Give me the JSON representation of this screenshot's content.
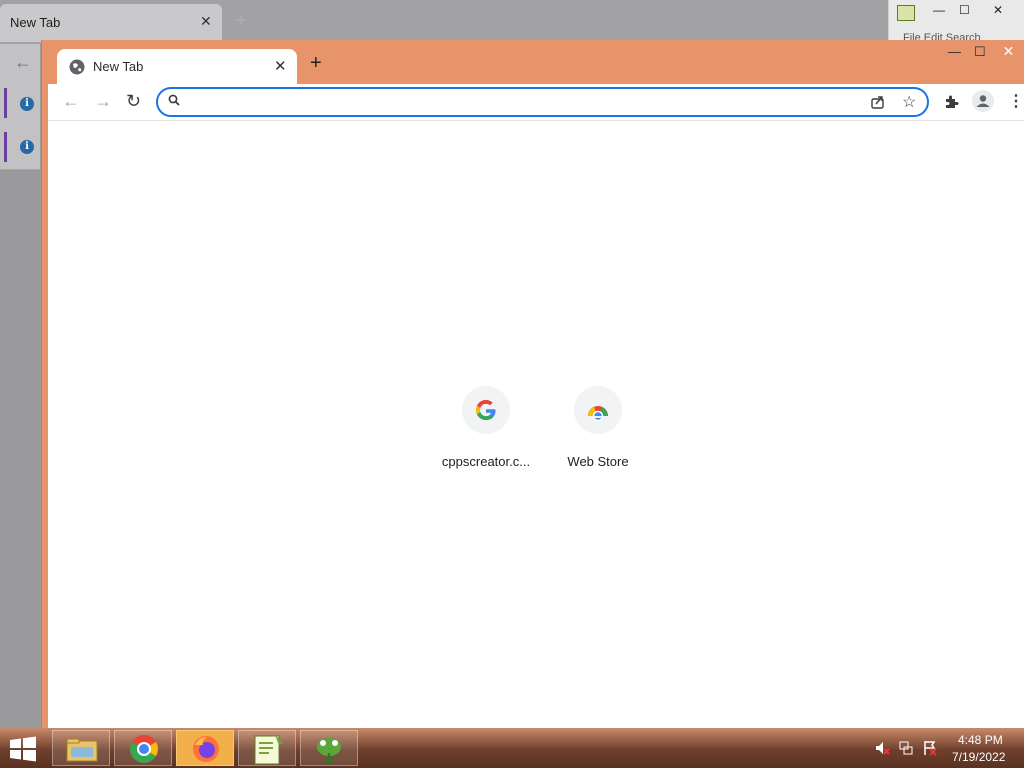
{
  "background_window": {
    "tab_title": "New Tab",
    "tab_close": "✕",
    "new_tab": "+",
    "back": "←",
    "info_glyph": "i"
  },
  "notepad": {
    "menu": "File   Edit   Search",
    "min": "—",
    "max": "☐",
    "close": "✕"
  },
  "chrome": {
    "accent_color": "#e8946a",
    "tab": {
      "title": "New Tab",
      "close": "✕"
    },
    "new_tab": "+",
    "frame": {
      "min": "—",
      "max": "☐",
      "close": "✕"
    },
    "toolbar": {
      "back": "←",
      "forward": "→",
      "reload": "↻",
      "omnibox_value": "",
      "omnibox_placeholder": "",
      "star": "☆",
      "menu": "⋮"
    },
    "shortcuts": [
      {
        "label": "cppscreator.c...",
        "icon": "google-icon",
        "glyph": "G"
      },
      {
        "label": "Web Store",
        "icon": "web-store-icon"
      }
    ]
  },
  "taskbar": {
    "apps": [
      {
        "name": "file-explorer-icon"
      },
      {
        "name": "chrome-icon"
      },
      {
        "name": "firefox-icon",
        "active": true
      },
      {
        "name": "notepad-plus-plus-icon"
      },
      {
        "name": "installer-icon"
      }
    ],
    "tray_icons": [
      "volume-muted-icon",
      "network-icon",
      "flag-icon"
    ],
    "time": "4:48 PM",
    "date": "7/19/2022"
  }
}
